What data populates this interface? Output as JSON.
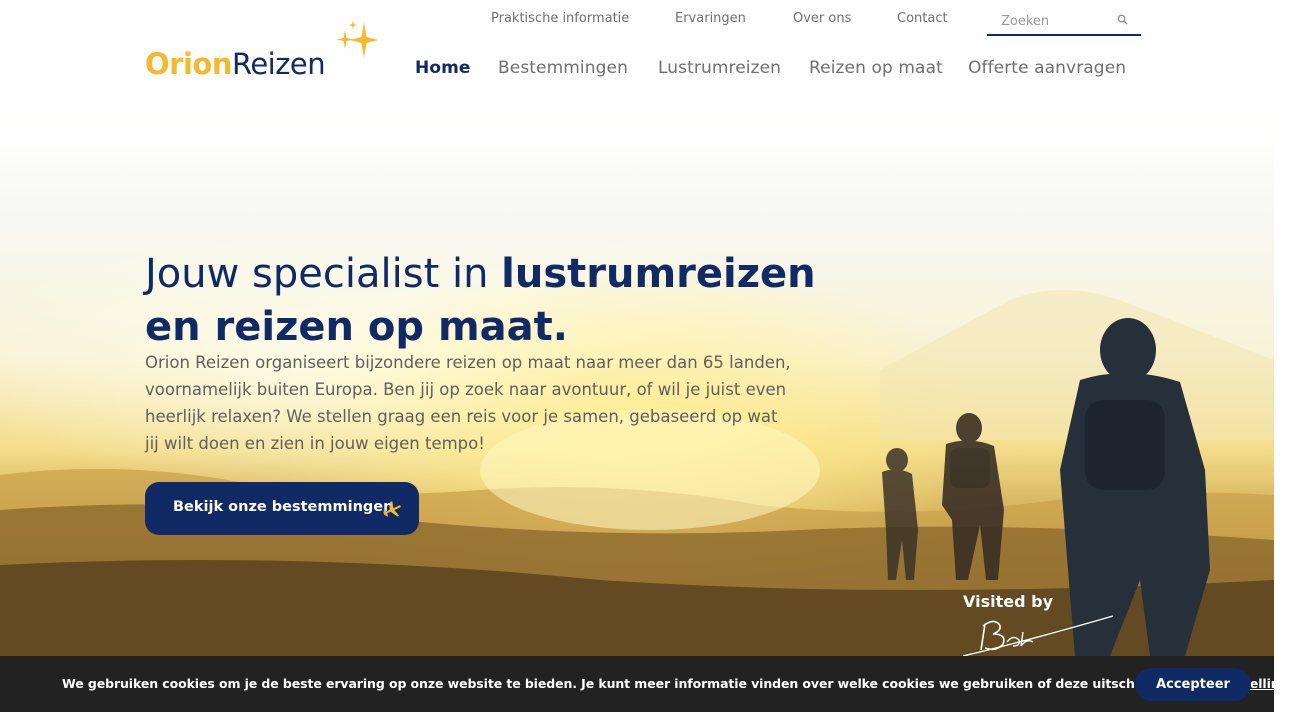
{
  "brand": {
    "logo_part1": "Orion",
    "logo_part2": "Reizen",
    "colors": {
      "navy": "#102a66",
      "gold": "#f4b92c"
    }
  },
  "topnav": {
    "items": [
      "Praktische informatie",
      "Ervaringen",
      "Over ons",
      "Contact"
    ],
    "search_placeholder": "Zoeken",
    "search_icon": "search-icon"
  },
  "mainnav": {
    "items": [
      "Home",
      "Bestemmingen",
      "Lustrumreizen",
      "Reizen op maat",
      "Offerte aanvragen"
    ],
    "active": "Home"
  },
  "hero": {
    "headline_light": "Jouw specialist in ",
    "headline_bold": "lustrumreizen en reizen op maat.",
    "intro": "Orion Reizen organiseert bijzondere reizen op maat naar meer dan 65 landen, voornamelijk buiten Europa. Ben jij op zoek naar avontuur, of wil je juist even heerlijk relaxen? We stellen graag een reis voor je samen, gebaseerd op wat jij wilt doen en zien in jouw eigen tempo!",
    "cta_label": "Bekijk onze bestemmingen",
    "cta_icon": "plane-icon",
    "visited_label": "Visited by"
  },
  "cookie": {
    "text": "We gebruiken cookies om je de beste ervaring op onze website te bieden. Je kunt meer informatie vinden over welke cookies we gebruiken of deze uitschakelen in de ",
    "link": "instellingen",
    "accept_label": "Accepteer"
  }
}
